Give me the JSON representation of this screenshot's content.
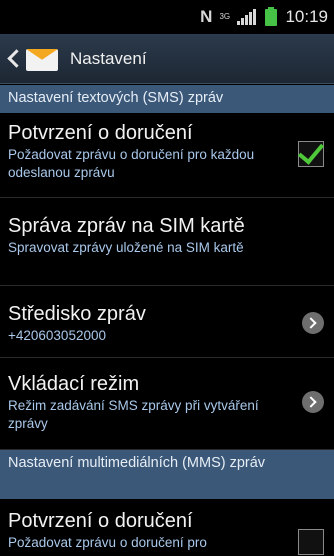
{
  "status_bar": {
    "network_icon": "nfc-n-icon",
    "network_label": "N",
    "data_label": "3G",
    "signal_icon": "signal-icon",
    "battery_icon": "battery-icon",
    "time": "10:19"
  },
  "action_bar": {
    "back_icon": "back-icon",
    "app_icon": "messages-envelope-icon",
    "title": "Nastavení"
  },
  "sections": {
    "sms_header": "Nastavení textových (SMS) zpráv",
    "mms_header": "Nastavení multimediálních (MMS) zpráv"
  },
  "items": [
    {
      "title": "Potvrzení o doručení",
      "subtitle": "Požadovat zprávu o doručení pro každou odeslanou zprávu",
      "control": "checkbox",
      "checked": true
    },
    {
      "title": "Správa zpráv na SIM kartě",
      "subtitle": "Spravovat zprávy uložené na SIM kartě",
      "control": "none"
    },
    {
      "title": "Středisko zpráv",
      "subtitle": "+420603052000",
      "control": "chevron"
    },
    {
      "title": "Vkládací režim",
      "subtitle": "Režim zadávání SMS zprávy při vytváření zprávy",
      "control": "chevron"
    },
    {
      "title": "Potvrzení o doručení",
      "subtitle": "Požadovat zprávu o doručení pro",
      "control": "checkbox",
      "checked": false
    }
  ],
  "colors": {
    "section_header_bg": "#3b5879",
    "subtitle_text": "#a9c8ea",
    "check_green": "#4fc93a",
    "battery_green": "#46c246"
  }
}
